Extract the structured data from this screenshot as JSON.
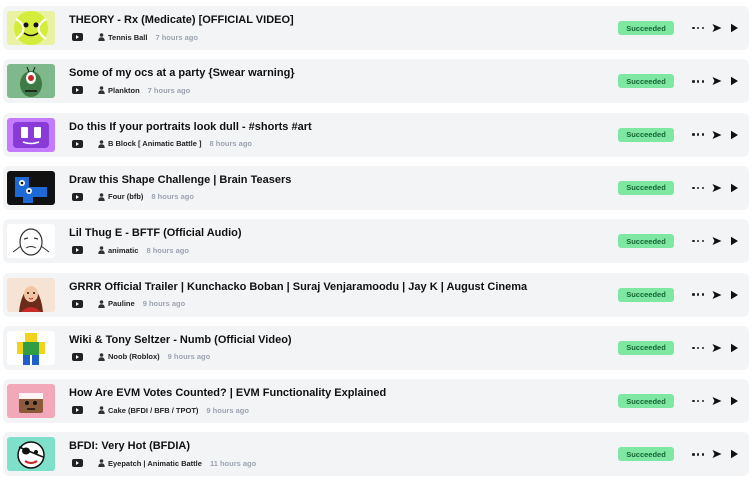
{
  "items": [
    {
      "title": "THEORY - Rx (Medicate) [OFFICIAL VIDEO]",
      "author": "Tennis Ball",
      "time": "7 hours ago",
      "status": "Succeeded",
      "thumb_icon": "tennis-ball-thumbnail",
      "thumb_colors": [
        "#d4ed3a",
        "#a8c41a"
      ]
    },
    {
      "title": "Some of my ocs at a party {Swear warning}",
      "author": "Plankton",
      "time": "7 hours ago",
      "status": "Succeeded",
      "thumb_icon": "plankton-thumbnail",
      "thumb_colors": [
        "#7fb88a",
        "#3d7a45"
      ]
    },
    {
      "title": "Do this If your portraits look dull - #shorts #art",
      "author": "B Block [ Animatic Battle ]",
      "time": "8 hours ago",
      "status": "Succeeded",
      "thumb_icon": "purple-block-thumbnail",
      "thumb_colors": [
        "#8a3ad6",
        "#c47bff"
      ]
    },
    {
      "title": "Draw this Shape Challenge | Brain Teasers",
      "author": "Four (bfb)",
      "time": "8 hours ago",
      "status": "Succeeded",
      "thumb_icon": "four-bfb-thumbnail",
      "thumb_colors": [
        "#1d6ad6",
        "#111111"
      ]
    },
    {
      "title": "Lil Thug E - BFTF (Official Audio)",
      "author": "animatic",
      "time": "8 hours ago",
      "status": "Succeeded",
      "thumb_icon": "sketch-character-thumbnail",
      "thumb_colors": [
        "#ffffff",
        "#333333"
      ]
    },
    {
      "title": "GRRR Official Trailer | Kunchacko Boban | Suraj Venjaramoodu | Jay K | August Cinema",
      "author": "Pauline",
      "time": "9 hours ago",
      "status": "Succeeded",
      "thumb_icon": "pauline-thumbnail",
      "thumb_colors": [
        "#c92a2a",
        "#6b2c1a"
      ]
    },
    {
      "title": "Wiki & Tony Seltzer - Numb (Official Video)",
      "author": "Noob (Roblox)",
      "time": "9 hours ago",
      "status": "Succeeded",
      "thumb_icon": "roblox-noob-thumbnail",
      "thumb_colors": [
        "#f2d21b",
        "#1e5fc9"
      ]
    },
    {
      "title": "How Are EVM Votes Counted? | EVM Functionality Explained",
      "author": "Cake (BFDI / BFB / TPOT)",
      "time": "9 hours ago",
      "status": "Succeeded",
      "thumb_icon": "cake-thumbnail",
      "thumb_colors": [
        "#f2a8b8",
        "#8a5a3a"
      ]
    },
    {
      "title": "BFDI: Very Hot (BFDIA)",
      "author": "Eyepatch | Animatic Battle",
      "time": "11 hours ago",
      "status": "Succeeded",
      "thumb_icon": "eyepatch-thumbnail",
      "thumb_colors": [
        "#7ee0c8",
        "#111111"
      ]
    }
  ],
  "icons": {
    "source": "youtube-icon",
    "author": "person-icon",
    "more": "more-dots-icon",
    "send": "send-icon",
    "play": "play-icon"
  },
  "colors": {
    "row_bg": "#f3f4f6",
    "badge_bg": "#7ee8a3",
    "badge_text": "#166534",
    "muted": "#9ca3af"
  }
}
